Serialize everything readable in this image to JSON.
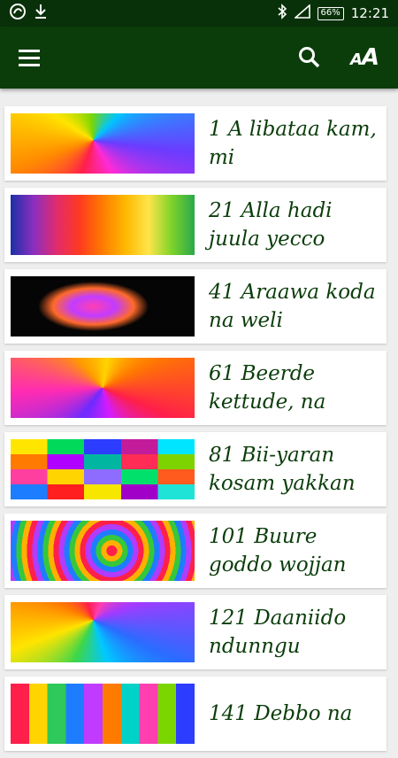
{
  "status_bar": {
    "battery": "66%",
    "time": "12:21",
    "icons": [
      "app-logo-icon",
      "download-icon",
      "bluetooth-icon",
      "signal-icon",
      "battery-icon"
    ]
  },
  "app_bar": {
    "icons": [
      "menu-icon",
      "search-icon",
      "font-size-icon"
    ],
    "font_size_label_small": "A",
    "font_size_label_large": "A",
    "background_color": "#0b3d0b"
  },
  "items": [
    {
      "title": "1 A libataa kam, mi"
    },
    {
      "title": "21 Alla hadi juula yecco"
    },
    {
      "title": "41 Araawa koda na weli"
    },
    {
      "title": "61 Beerde kettude, na"
    },
    {
      "title": "81 Bii-yaran kosam yakkan"
    },
    {
      "title": "101 Buure goddo wojjan"
    },
    {
      "title": "121 Daaniido ndunngu"
    },
    {
      "title": "141 Debbo na"
    }
  ]
}
